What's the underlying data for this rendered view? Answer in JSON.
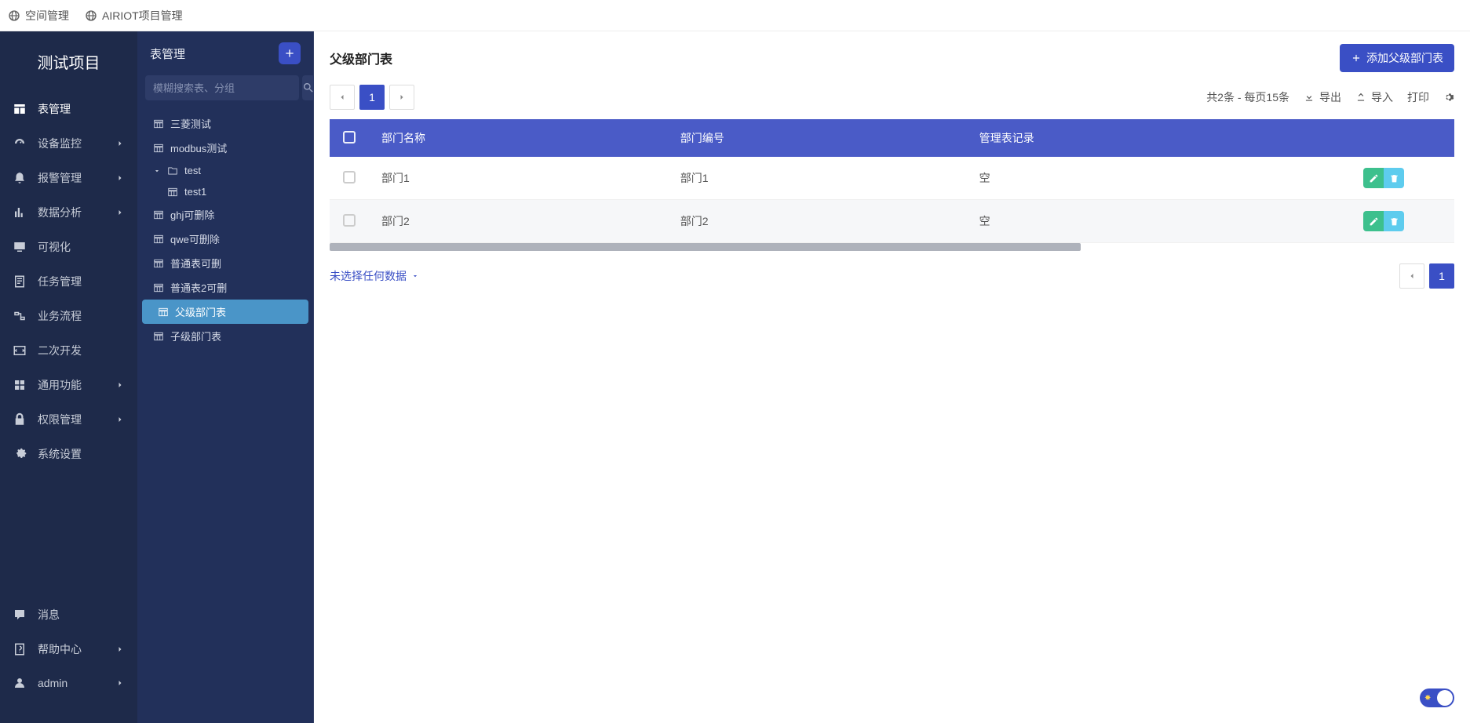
{
  "breadcrumb": [
    {
      "label": "空间管理"
    },
    {
      "label": "AIRIOT项目管理"
    }
  ],
  "project": {
    "title": "测试项目"
  },
  "nav": {
    "main": [
      {
        "label": "表管理",
        "icon": "table",
        "expandable": false,
        "active": true
      },
      {
        "label": "设备监控",
        "icon": "gauge",
        "expandable": true
      },
      {
        "label": "报警管理",
        "icon": "alarm",
        "expandable": true
      },
      {
        "label": "数据分析",
        "icon": "chart",
        "expandable": true
      },
      {
        "label": "可视化",
        "icon": "screen",
        "expandable": false
      },
      {
        "label": "任务管理",
        "icon": "task",
        "expandable": false
      },
      {
        "label": "业务流程",
        "icon": "flow",
        "expandable": false
      },
      {
        "label": "二次开发",
        "icon": "code",
        "expandable": false
      },
      {
        "label": "通用功能",
        "icon": "grid",
        "expandable": true
      },
      {
        "label": "权限管理",
        "icon": "lock",
        "expandable": true
      },
      {
        "label": "系统设置",
        "icon": "gear",
        "expandable": false
      }
    ],
    "bottom": [
      {
        "label": "消息",
        "icon": "message",
        "expandable": false
      },
      {
        "label": "帮助中心",
        "icon": "help",
        "expandable": true
      },
      {
        "label": "admin",
        "icon": "user",
        "expandable": true
      }
    ]
  },
  "secondary": {
    "title": "表管理",
    "search_placeholder": "模糊搜索表、分组",
    "tree": [
      {
        "label": "三菱测试",
        "icon": "table",
        "level": 1
      },
      {
        "label": "modbus测试",
        "icon": "table",
        "level": 1
      },
      {
        "label": "test",
        "icon": "folder",
        "level": 1,
        "folder": true,
        "expanded": true
      },
      {
        "label": "test1",
        "icon": "table",
        "level": 2
      },
      {
        "label": "ghj可删除",
        "icon": "table",
        "level": 1
      },
      {
        "label": "qwe可删除",
        "icon": "table",
        "level": 1
      },
      {
        "label": "普通表可删",
        "icon": "table",
        "level": 1
      },
      {
        "label": "普通表2可删",
        "icon": "table",
        "level": 1
      },
      {
        "label": "父级部门表",
        "icon": "table",
        "level": 1,
        "selected": true
      },
      {
        "label": "子级部门表",
        "icon": "table",
        "level": 1
      }
    ]
  },
  "content": {
    "title": "父级部门表",
    "add_button": "添加父级部门表",
    "page_info": "共2条 - 每页15条",
    "actions": {
      "export": "导出",
      "import": "导入",
      "print": "打印"
    },
    "pagination": {
      "current": "1"
    },
    "columns": [
      "部门名称",
      "部门编号",
      "管理表记录"
    ],
    "rows": [
      {
        "name": "部门1",
        "code": "部门1",
        "records": "空"
      },
      {
        "name": "部门2",
        "code": "部门2",
        "records": "空"
      }
    ],
    "selection_status": "未选择任何数据",
    "bottom_page": "1"
  }
}
